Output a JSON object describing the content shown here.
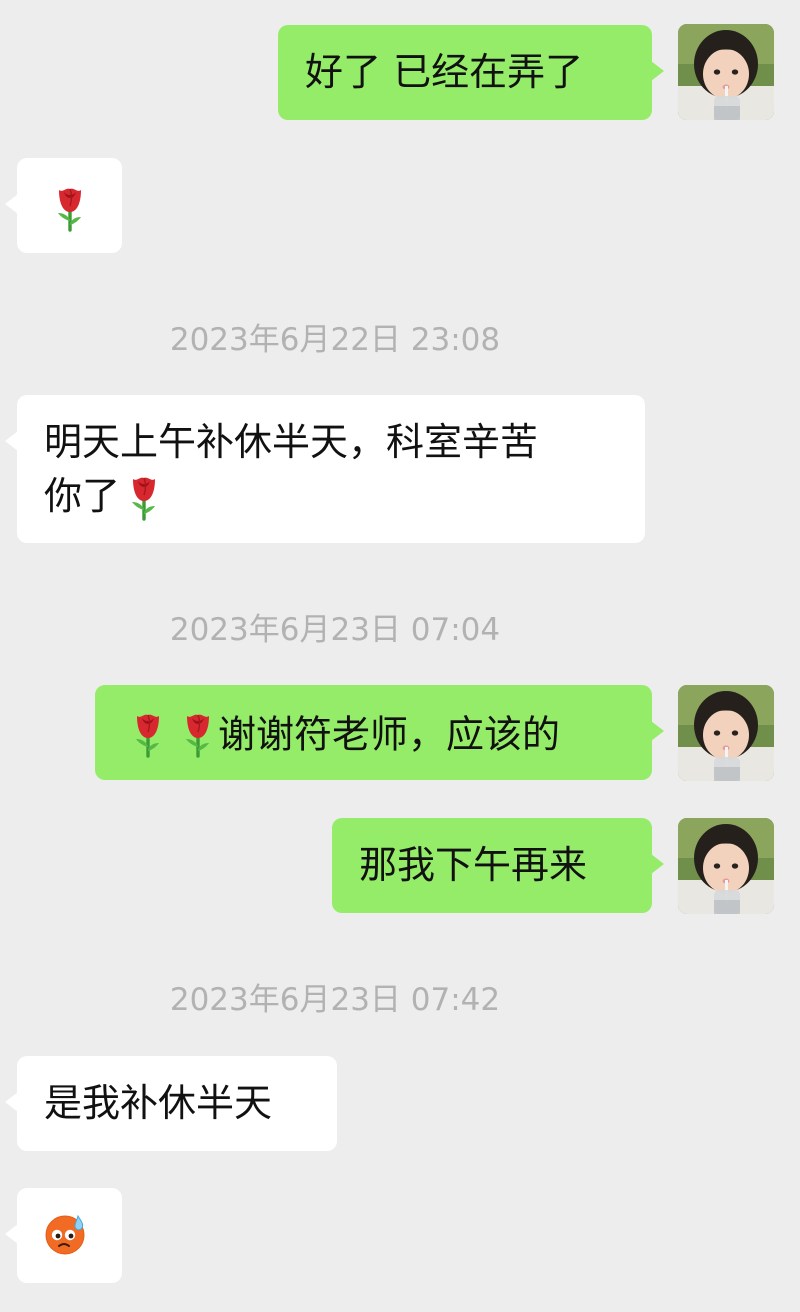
{
  "messages": [
    {
      "id": "m1",
      "sender": "me",
      "text": "好了 已经在弄了"
    },
    {
      "id": "m2",
      "sender": "other",
      "emoji": "rose"
    },
    {
      "id": "t1",
      "type": "timestamp",
      "text": "2023年6月22日 23:08"
    },
    {
      "id": "m3",
      "sender": "other",
      "text_line1": "明天上午补休半天，科室辛苦",
      "text_line2": "你了",
      "trailing_emoji": "rose"
    },
    {
      "id": "t2",
      "type": "timestamp",
      "text": "2023年6月23日 07:04"
    },
    {
      "id": "m4",
      "sender": "me",
      "leading_emojis": [
        "rose",
        "rose"
      ],
      "text": "谢谢符老师，应该的"
    },
    {
      "id": "m5",
      "sender": "me",
      "text": "那我下午再来"
    },
    {
      "id": "t3",
      "type": "timestamp",
      "text": "2023年6月23日 07:42"
    },
    {
      "id": "m6",
      "sender": "other",
      "text": "是我补休半天"
    },
    {
      "id": "m7",
      "sender": "other",
      "emoji": "sweat-face"
    }
  ],
  "colors": {
    "background": "#ededed",
    "my_bubble": "#95ec69",
    "other_bubble": "#ffffff",
    "timestamp_text": "#b2b2b2"
  },
  "icons": {
    "rose": "rose-icon",
    "sweat_face": "anxious-sweat-face-icon",
    "avatar": "user-avatar-photo"
  }
}
